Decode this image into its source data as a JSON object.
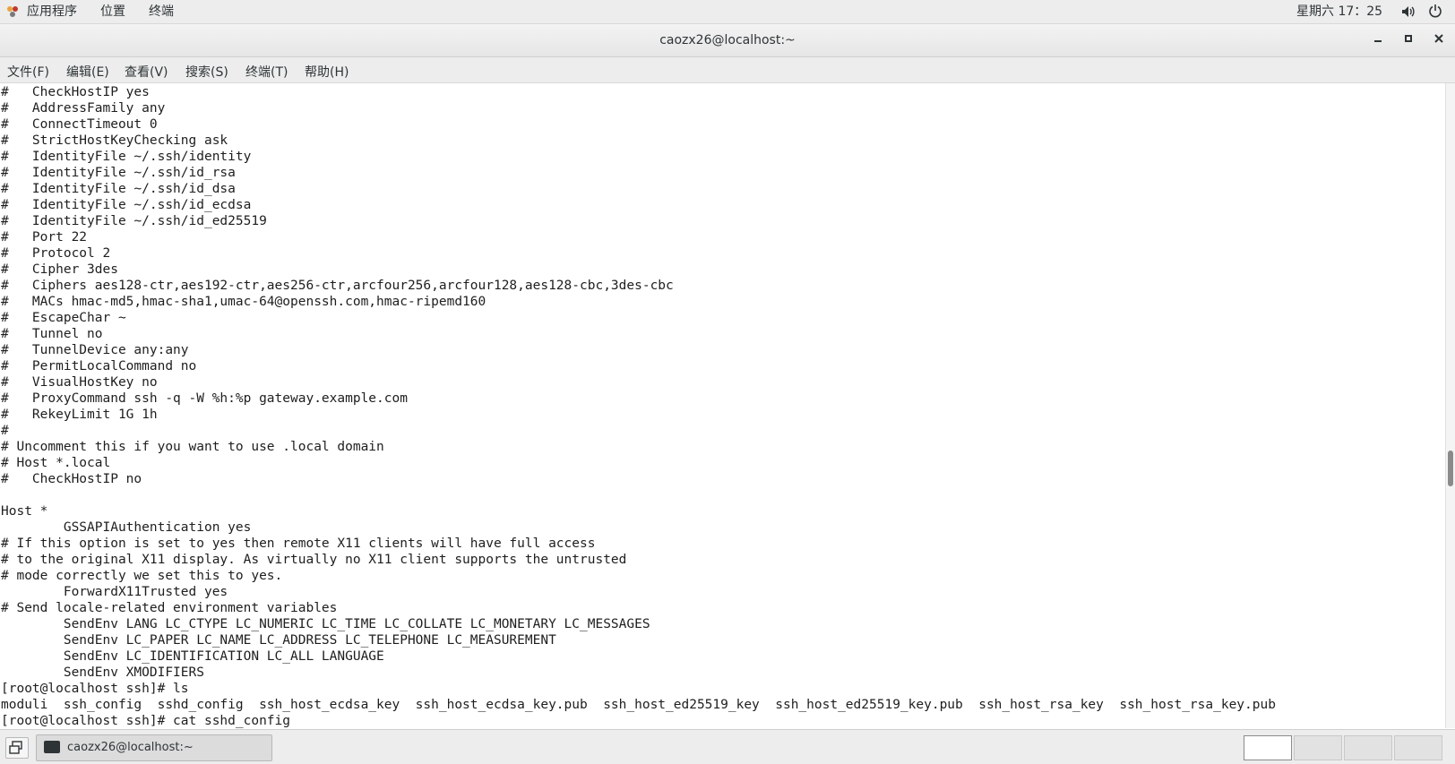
{
  "top_panel": {
    "apps": "应用程序",
    "places": "位置",
    "terminal": "终端",
    "clock": "星期六 17：25",
    "icons": [
      "apps-icon",
      "volume-icon",
      "power-icon"
    ]
  },
  "window": {
    "title": "caozx26@localhost:~",
    "controls": [
      "minimize-icon",
      "maximize-icon",
      "close-icon"
    ]
  },
  "menu": [
    "文件(F)",
    "编辑(E)",
    "查看(V)",
    "搜索(S)",
    "终端(T)",
    "帮助(H)"
  ],
  "terminal": {
    "lines": [
      "#   CheckHostIP yes",
      "#   AddressFamily any",
      "#   ConnectTimeout 0",
      "#   StrictHostKeyChecking ask",
      "#   IdentityFile ~/.ssh/identity",
      "#   IdentityFile ~/.ssh/id_rsa",
      "#   IdentityFile ~/.ssh/id_dsa",
      "#   IdentityFile ~/.ssh/id_ecdsa",
      "#   IdentityFile ~/.ssh/id_ed25519",
      "#   Port 22",
      "#   Protocol 2",
      "#   Cipher 3des",
      "#   Ciphers aes128-ctr,aes192-ctr,aes256-ctr,arcfour256,arcfour128,aes128-cbc,3des-cbc",
      "#   MACs hmac-md5,hmac-sha1,umac-64@openssh.com,hmac-ripemd160",
      "#   EscapeChar ~",
      "#   Tunnel no",
      "#   TunnelDevice any:any",
      "#   PermitLocalCommand no",
      "#   VisualHostKey no",
      "#   ProxyCommand ssh -q -W %h:%p gateway.example.com",
      "#   RekeyLimit 1G 1h",
      "#",
      "# Uncomment this if you want to use .local domain",
      "# Host *.local",
      "#   CheckHostIP no",
      "",
      "Host *",
      "        GSSAPIAuthentication yes",
      "# If this option is set to yes then remote X11 clients will have full access",
      "# to the original X11 display. As virtually no X11 client supports the untrusted",
      "# mode correctly we set this to yes.",
      "        ForwardX11Trusted yes",
      "# Send locale-related environment variables",
      "        SendEnv LANG LC_CTYPE LC_NUMERIC LC_TIME LC_COLLATE LC_MONETARY LC_MESSAGES",
      "        SendEnv LC_PAPER LC_NAME LC_ADDRESS LC_TELEPHONE LC_MEASUREMENT",
      "        SendEnv LC_IDENTIFICATION LC_ALL LANGUAGE",
      "        SendEnv XMODIFIERS",
      "[root@localhost ssh]# ls",
      "moduli  ssh_config  sshd_config  ssh_host_ecdsa_key  ssh_host_ecdsa_key.pub  ssh_host_ed25519_key  ssh_host_ed25519_key.pub  ssh_host_rsa_key  ssh_host_rsa_key.pub",
      "[root@localhost ssh]# cat sshd_config"
    ]
  },
  "taskbar": {
    "window_label": "caozx26@localhost:~",
    "workspaces": 4,
    "active_workspace": 1
  }
}
